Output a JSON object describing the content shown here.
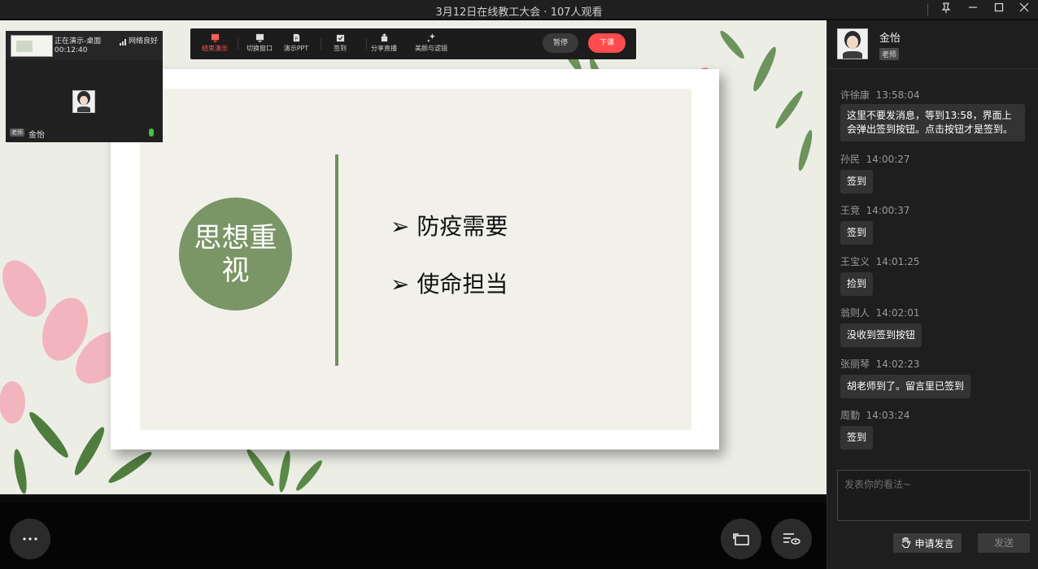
{
  "window": {
    "title": "3月12日在线教工大会 · 107人观看"
  },
  "toolbar": {
    "items": [
      "结束演示",
      "切换窗口",
      "演示PPT",
      "签到",
      "分享直播",
      "美颜与滤镜"
    ],
    "pause_label": "暂停",
    "end_class_label": "下课"
  },
  "preview": {
    "status": "正在演示-桌面",
    "network": "网络良好",
    "timer": "00:12:40",
    "role_badge": "老师",
    "name": "金怡"
  },
  "slide": {
    "circle_text": "思想重视",
    "bullets": [
      "➢ 防疫需要",
      "➢ 使命担当"
    ]
  },
  "sidebar": {
    "host_name": "金怡",
    "host_badge": "老师",
    "messages": [
      {
        "name": "许徐康",
        "time": "13:58:04",
        "text": "这里不要发消息，等到13:58，界面上会弹出签到按钮。点击按钮才是签到。"
      },
      {
        "name": "孙民",
        "time": "14:00:27",
        "text": "签到"
      },
      {
        "name": "王竞",
        "time": "14:00:37",
        "text": "签到"
      },
      {
        "name": "王宝义",
        "time": "14:01:25",
        "text": "捡到"
      },
      {
        "name": "翁则人",
        "time": "14:02:01",
        "text": "没收到签到按钮"
      },
      {
        "name": "张丽琴",
        "time": "14:02:23",
        "text": "胡老师到了。留言里已签到"
      },
      {
        "name": "周勤",
        "time": "14:03:24",
        "text": "签到"
      }
    ],
    "input_placeholder": "发表你的看法~",
    "raise_hand_label": "申请发言",
    "send_label": "发送"
  },
  "colors": {
    "accent_red": "#ff4b4b",
    "slide_green": "#7a9566"
  }
}
